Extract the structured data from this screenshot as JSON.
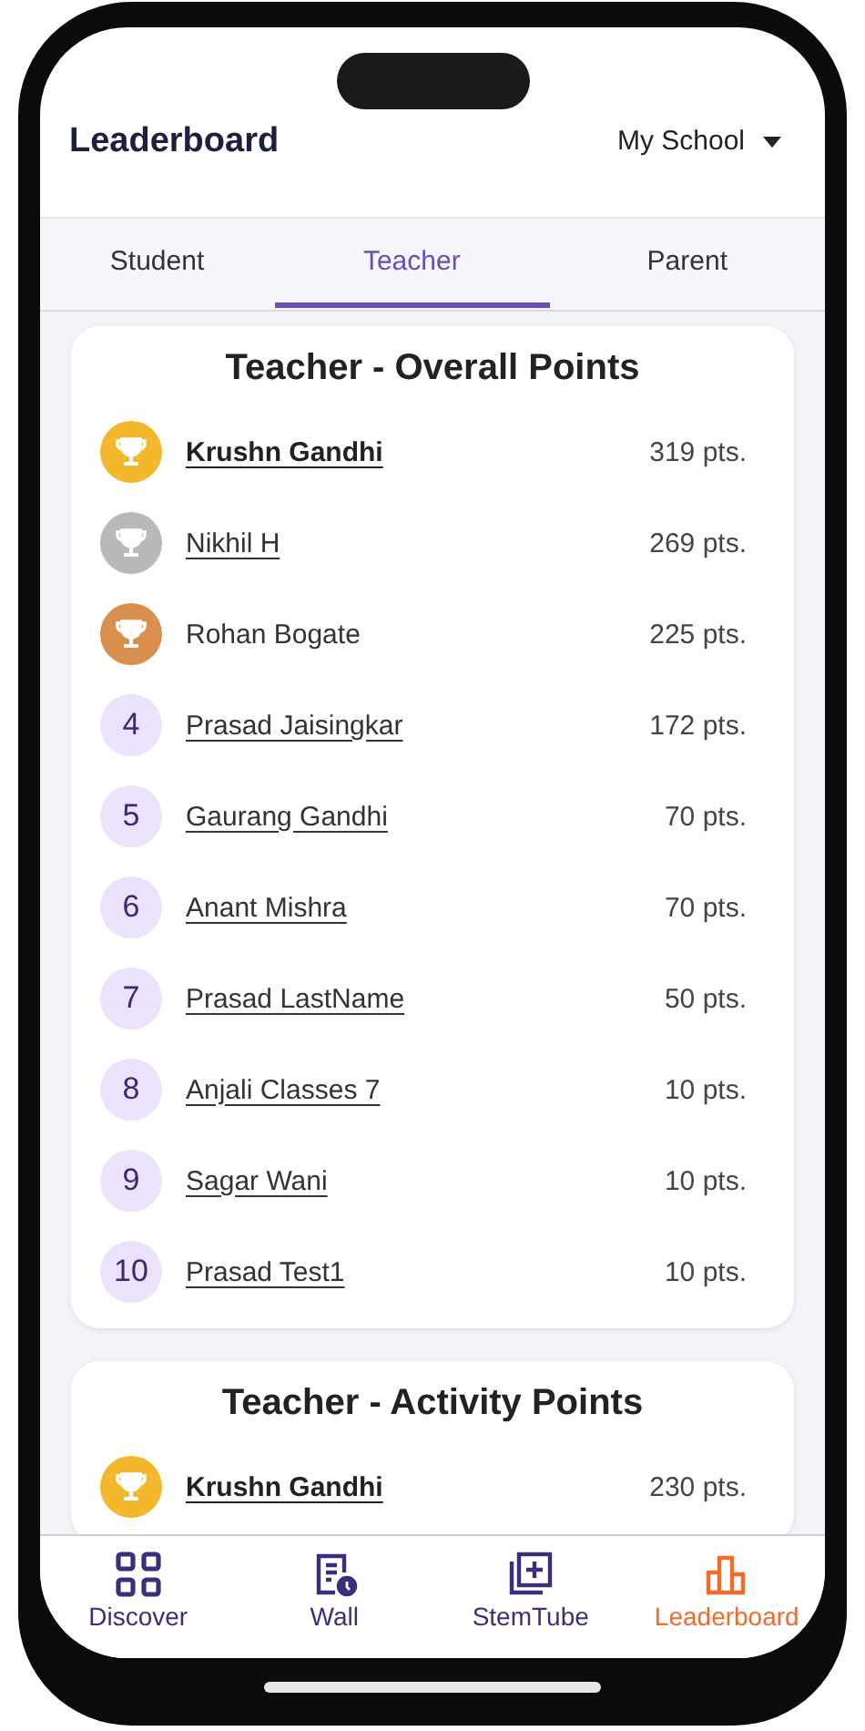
{
  "header": {
    "title": "Leaderboard",
    "scope_dropdown": "My School"
  },
  "tabs": [
    {
      "label": "Student",
      "selected": false
    },
    {
      "label": "Teacher",
      "selected": true
    },
    {
      "label": "Parent",
      "selected": false
    }
  ],
  "cards": [
    {
      "title": "Teacher - Overall Points",
      "rows": [
        {
          "kind": "gold",
          "name": "Krushn Gandhi",
          "linked": true,
          "emphasized": true,
          "points": "319 pts."
        },
        {
          "kind": "silver",
          "name": "Nikhil H",
          "linked": true,
          "emphasized": false,
          "points": "269 pts."
        },
        {
          "kind": "bronze",
          "name": "Rohan Bogate",
          "linked": false,
          "emphasized": false,
          "points": "225 pts."
        },
        {
          "kind": "number",
          "rank": "4",
          "name": "Prasad Jaisingkar",
          "linked": true,
          "emphasized": false,
          "points": "172 pts."
        },
        {
          "kind": "number",
          "rank": "5",
          "name": "Gaurang Gandhi",
          "linked": true,
          "emphasized": false,
          "points": "70 pts."
        },
        {
          "kind": "number",
          "rank": "6",
          "name": "Anant Mishra",
          "linked": true,
          "emphasized": false,
          "points": "70 pts."
        },
        {
          "kind": "number",
          "rank": "7",
          "name": "Prasad LastName",
          "linked": true,
          "emphasized": false,
          "points": "50 pts."
        },
        {
          "kind": "number",
          "rank": "8",
          "name": "Anjali Classes 7",
          "linked": true,
          "emphasized": false,
          "points": "10 pts."
        },
        {
          "kind": "number",
          "rank": "9",
          "name": "Sagar Wani",
          "linked": true,
          "emphasized": false,
          "points": "10 pts."
        },
        {
          "kind": "number",
          "rank": "10",
          "name": "Prasad Test1",
          "linked": true,
          "emphasized": false,
          "points": "10 pts."
        }
      ]
    },
    {
      "title": "Teacher - Activity Points",
      "rows": [
        {
          "kind": "gold",
          "name": "Krushn Gandhi",
          "linked": true,
          "emphasized": true,
          "points": "230 pts."
        }
      ]
    }
  ],
  "bottom_nav": [
    {
      "kind": "grid",
      "label": "Discover",
      "selected": false
    },
    {
      "kind": "wall",
      "label": "Wall",
      "selected": false
    },
    {
      "kind": "stemtube",
      "label": "StemTube",
      "selected": false
    },
    {
      "kind": "chart",
      "label": "Leaderboard",
      "selected": true
    }
  ]
}
